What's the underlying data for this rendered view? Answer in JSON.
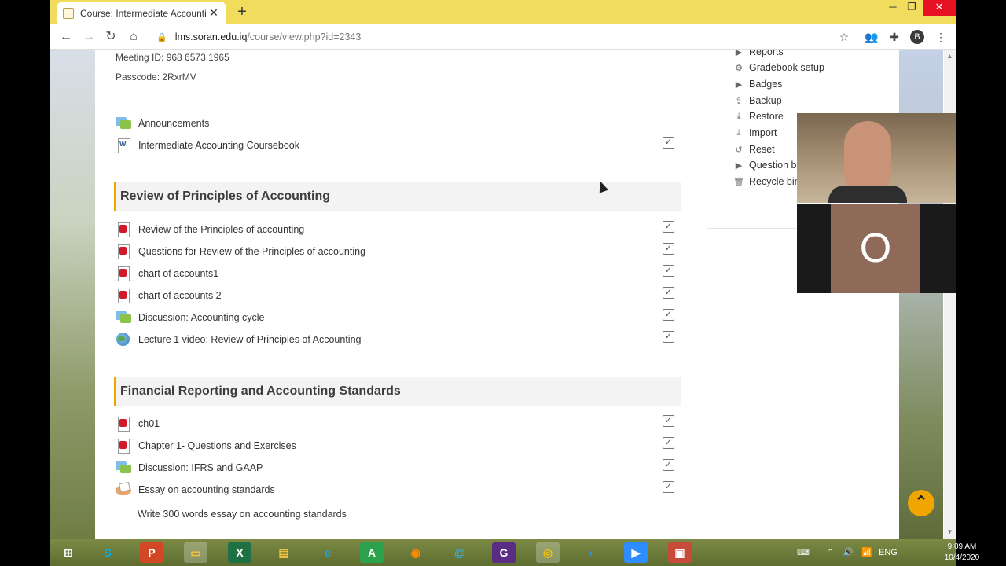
{
  "browser": {
    "tab_title": "Course: Intermediate Accounting",
    "url_host": "lms.soran.edu.iq",
    "url_path": "/course/view.php?id=2343",
    "profile_initial": "B"
  },
  "course": {
    "meeting_id": "Meeting ID: 968 6573 1965",
    "passcode": "Passcode: 2RxrMV",
    "general_items": [
      {
        "label": "Announcements",
        "icon": "forum-icon"
      },
      {
        "label": "Intermediate Accounting Coursebook",
        "icon": "word-icon"
      }
    ],
    "sections": [
      {
        "title": "Review of Principles of Accounting",
        "items": [
          {
            "label": "Review of the Principles of accounting",
            "icon": "pdf-icon"
          },
          {
            "label": "Questions for Review of the Principles of accounting",
            "icon": "pdf-icon"
          },
          {
            "label": "chart of accounts1",
            "icon": "pdf-icon"
          },
          {
            "label": "chart of accounts 2",
            "icon": "pdf-icon"
          },
          {
            "label": "Discussion: Accounting cycle",
            "icon": "forum-icon"
          },
          {
            "label": "Lecture 1 video: Review of Principles of Accounting",
            "icon": "url-icon"
          }
        ]
      },
      {
        "title": "Financial Reporting and Accounting Standards",
        "items": [
          {
            "label": "ch01",
            "icon": "pdf-icon"
          },
          {
            "label": "Chapter 1- Questions and Exercises",
            "icon": "pdf-icon"
          },
          {
            "label": "Discussion: IFRS and GAAP",
            "icon": "forum-icon"
          },
          {
            "label": "Essay on accounting standards",
            "icon": "assignment-icon"
          }
        ],
        "essay_description": "Write 300 words essay on accounting standards"
      }
    ]
  },
  "admin": {
    "items": [
      {
        "label": "Reports",
        "icon": "triangle-right-icon"
      },
      {
        "label": "Gradebook setup",
        "icon": "gear-icon"
      },
      {
        "label": "Badges",
        "icon": "triangle-right-icon"
      },
      {
        "label": "Backup",
        "icon": "upload-icon"
      },
      {
        "label": "Restore",
        "icon": "download-icon"
      },
      {
        "label": "Import",
        "icon": "download-icon"
      },
      {
        "label": "Reset",
        "icon": "reset-icon"
      },
      {
        "label": "Question ba",
        "icon": "triangle-right-icon"
      },
      {
        "label": "Recycle bin",
        "icon": "trash-icon"
      }
    ]
  },
  "video": {
    "avatar_letter": "O"
  },
  "taskbar": {
    "language": "ENG",
    "time": "9:09 AM",
    "date": "10/4/2020"
  }
}
